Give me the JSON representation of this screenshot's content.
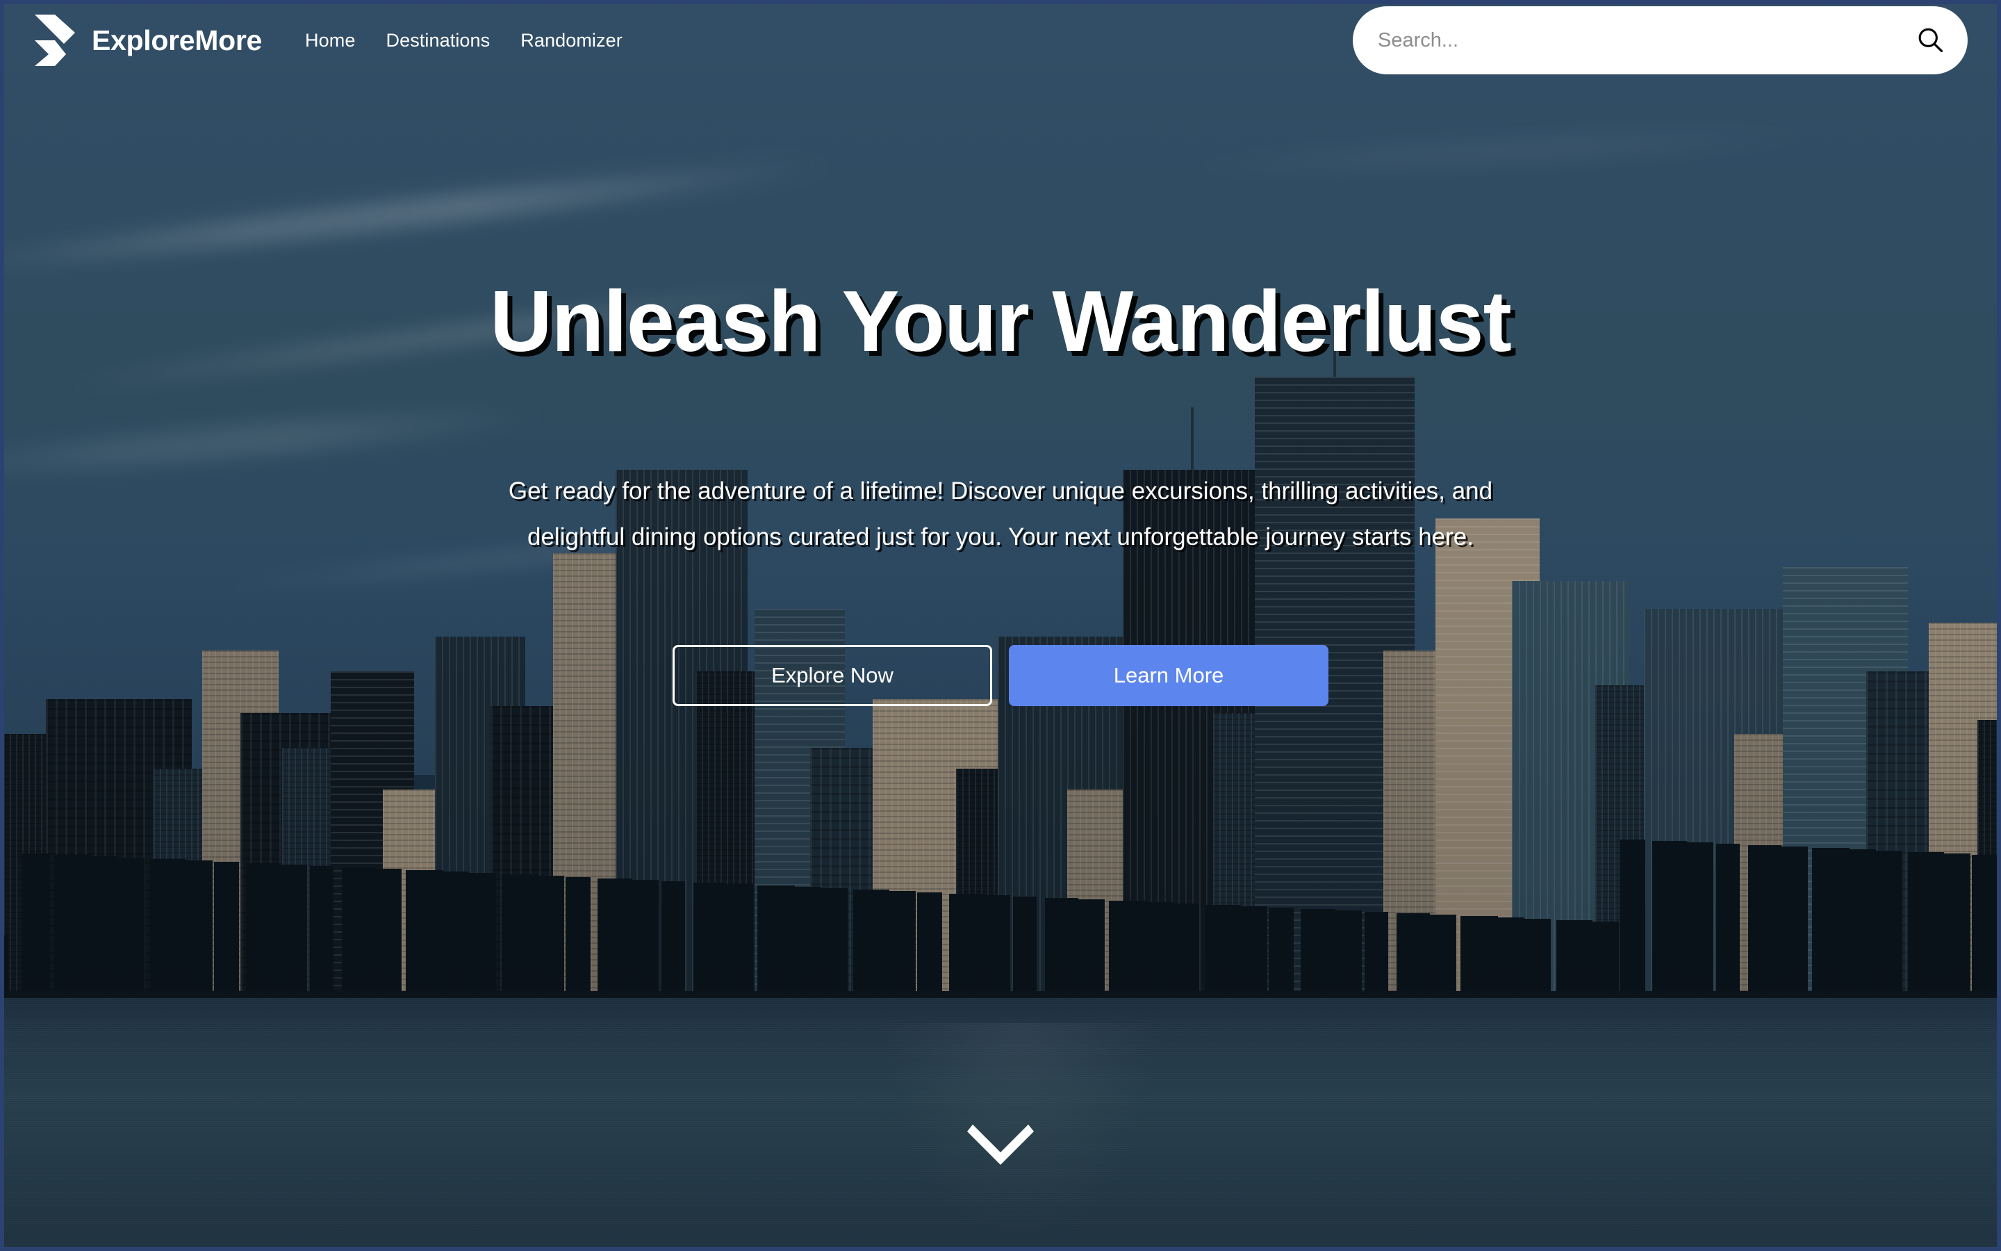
{
  "brand": {
    "name": "ExploreMore",
    "logo_icon": "flutter-logo-icon"
  },
  "nav": {
    "items": [
      {
        "label": "Home"
      },
      {
        "label": "Destinations"
      },
      {
        "label": "Randomizer"
      }
    ]
  },
  "search": {
    "value": "",
    "placeholder": "Search...",
    "icon": "search-icon"
  },
  "hero": {
    "headline": "Unleash Your Wanderlust",
    "subtext": "Get ready for the adventure of a lifetime! Discover unique excursions, thrilling activities, and delightful dining options curated just for you. Your next unforgettable journey starts here.",
    "primary_button": "Explore Now",
    "secondary_button": "Learn More",
    "scroll_icon": "chevron-down-icon",
    "background": "city-skyline-photo"
  },
  "colors": {
    "accent_blue": "#5D85EE",
    "page_border": "#2C4270",
    "sky": "#37566F",
    "water": "#2F4A5A",
    "text_on_hero": "#FFFFFF"
  }
}
